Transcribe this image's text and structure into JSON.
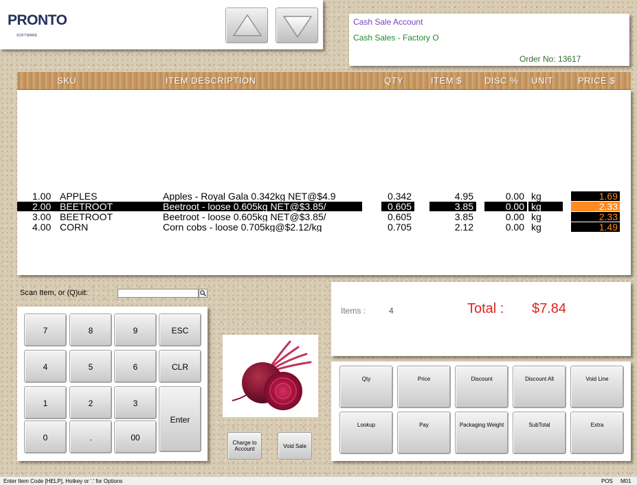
{
  "logo": {
    "name": "PRONTO",
    "sub": "SOFTWARE"
  },
  "account": {
    "line1": "Cash Sale Account",
    "line2": "Cash Sales - Factory O",
    "order": "Order No: 13617"
  },
  "columns": {
    "sku": "SKU",
    "desc": "ITEM DESCRIPTION",
    "qty": "QTY",
    "item_price": "ITEM $",
    "disc": "DISC %",
    "unit": "UNIT",
    "price": "PRICE $"
  },
  "rows": [
    {
      "num": "1.00",
      "sku": "APPLES",
      "desc": "Apples - Royal Gala 0.342kg NET@$4.9",
      "qty": "0.342",
      "item_price": "4.95",
      "disc": "0.00",
      "unit": "kg",
      "price": "1.69"
    },
    {
      "num": "2.00",
      "sku": "BEETROOT",
      "desc": "Beetroot - loose    0.605kg NET@$3.85/",
      "qty": "0.605",
      "item_price": "3.85",
      "disc": "0.00",
      "unit": "kg",
      "price": "2.33"
    },
    {
      "num": "3.00",
      "sku": "BEETROOT",
      "desc": "Beetroot - loose    0.605kg NET@$3.85/",
      "qty": "0.605",
      "item_price": "3.85",
      "disc": "0.00",
      "unit": "kg",
      "price": "2.33"
    },
    {
      "num": "4.00",
      "sku": "CORN",
      "desc": "Corn cobs - loose         0.705kg@$2.12/kg",
      "qty": "0.705",
      "item_price": "2.12",
      "disc": "0.00",
      "unit": "kg",
      "price": "1.49"
    }
  ],
  "scan": {
    "label": "Scan Item, or (Q)uit:",
    "value": ""
  },
  "keypad": {
    "k7": "7",
    "k8": "8",
    "k9": "9",
    "esc": "ESC",
    "k4": "4",
    "k5": "5",
    "k6": "6",
    "clr": "CLR",
    "k1": "1",
    "k2": "2",
    "k3": "3",
    "enter": "Enter",
    "k0": "0",
    "dot": ".",
    "k00": "00"
  },
  "actions": {
    "charge": "Charge to Account",
    "void_sale": "Void Sale"
  },
  "totals": {
    "items_label": "Items :",
    "items_value": "4",
    "total_label": "Total :",
    "total_value": "$7.84"
  },
  "functions": {
    "qty": "Qty",
    "price": "Price",
    "discount": "Discount",
    "discount_all": "Discount All",
    "void_line": "Void Line",
    "lookup": "Lookup",
    "pay": "Pay",
    "packaging": "Packaging Weight",
    "subtotal": "SubTotal",
    "extra": "Extra"
  },
  "status": {
    "hint": "Enter Item Code [HELP], Hotkey or '.' for Options",
    "pos": "POS",
    "mode": "M01"
  },
  "colors": {
    "total_red": "#e0231d",
    "price_orange": "#ff8a1f",
    "account_purple": "#7a3fbf",
    "account_green": "#1d8a2c"
  },
  "icons": {
    "up": "up-arrow-icon",
    "down": "down-arrow-icon",
    "scan": "magnifier-icon",
    "product": "beetroot-image"
  }
}
